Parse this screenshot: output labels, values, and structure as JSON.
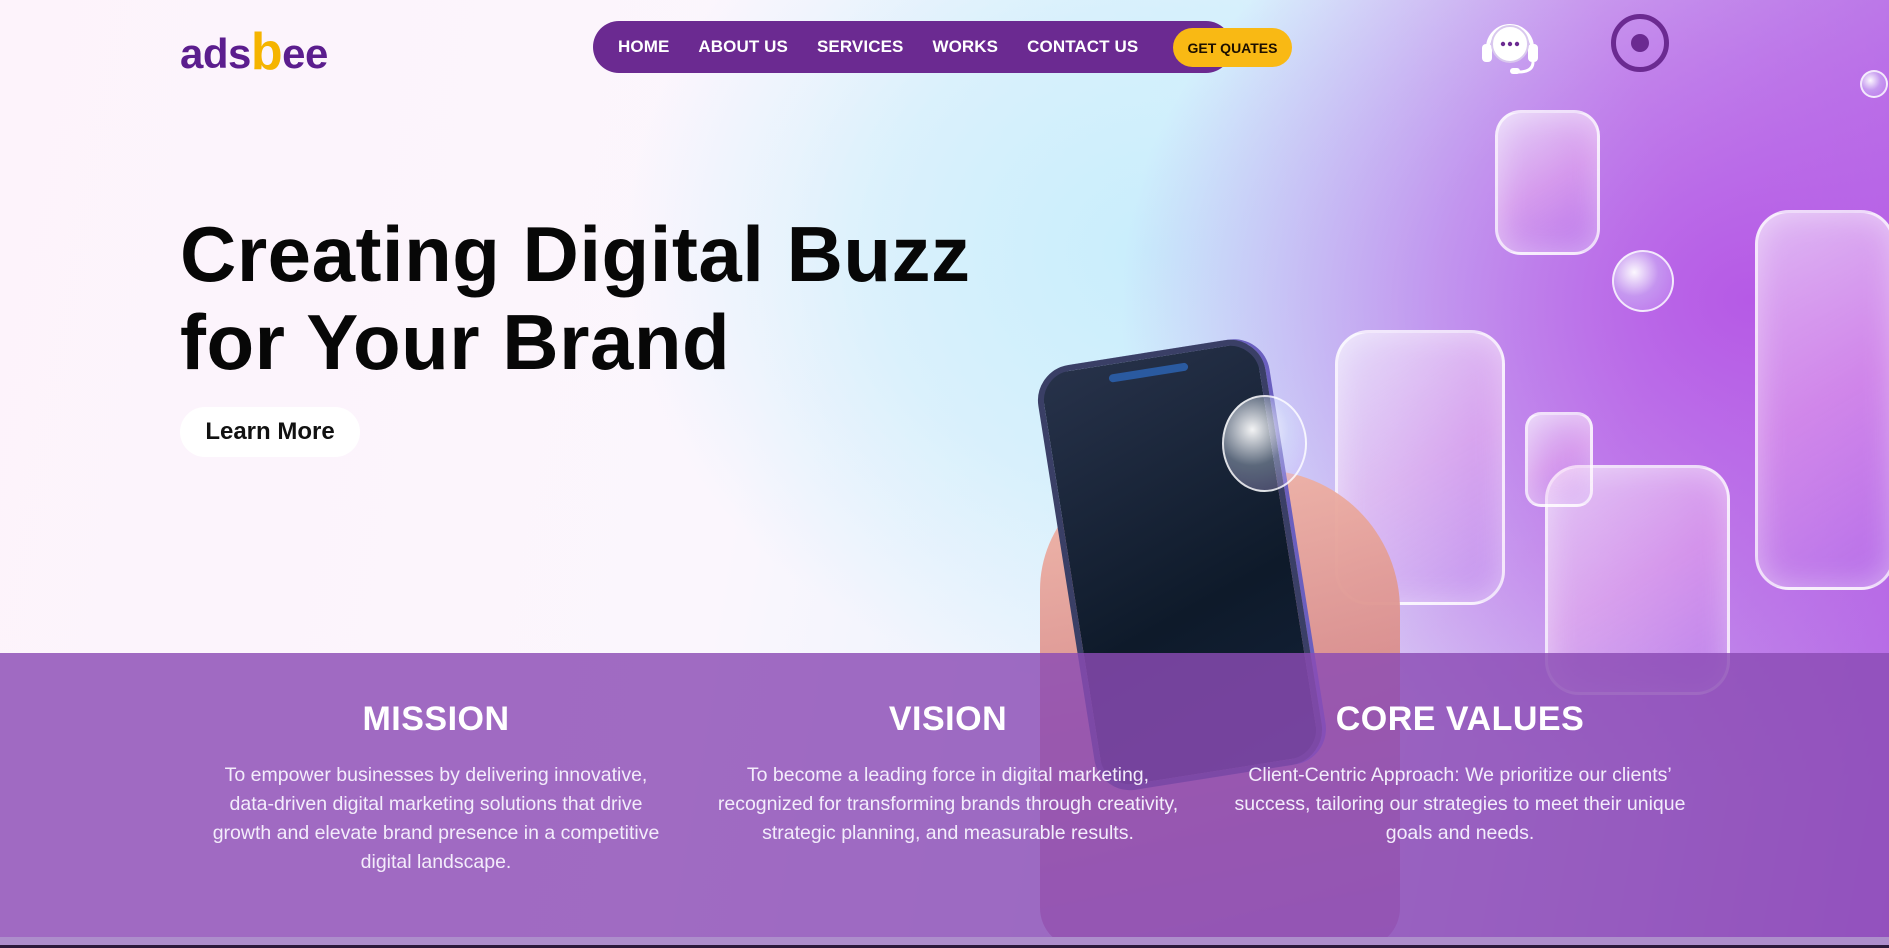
{
  "header": {
    "logo_text_1": "ads",
    "logo_text_b": "b",
    "logo_text_2": "ee",
    "nav": [
      "HOME",
      "ABOUT US",
      "SERVICES",
      "WORKS",
      "CONTACT US"
    ],
    "cta_label": "GET QUATES"
  },
  "hero": {
    "title_line1": "Creating Digital Buzz",
    "title_line2": "for Your Brand",
    "button_label": "Learn More"
  },
  "band": {
    "columns": [
      {
        "heading": "MISSION",
        "text": "To empower businesses by delivering innovative, data-driven digital marketing solutions that drive growth and elevate brand presence in a competitive digital landscape."
      },
      {
        "heading": "VISION",
        "text": "To become a leading force in digital marketing, recognized for transforming brands through creativity, strategic planning, and measurable results."
      },
      {
        "heading": "CORE VALUES",
        "text": "Client-Centric Approach: We prioritize our clients’ success, tailoring our strategies to meet their unique goals and needs."
      }
    ]
  },
  "colors": {
    "brand_purple": "#6b2a91",
    "brand_yellow": "#f9b914",
    "band_purple": "#8b4cb4"
  },
  "icons": [
    "support-headset-icon",
    "target-icon"
  ]
}
